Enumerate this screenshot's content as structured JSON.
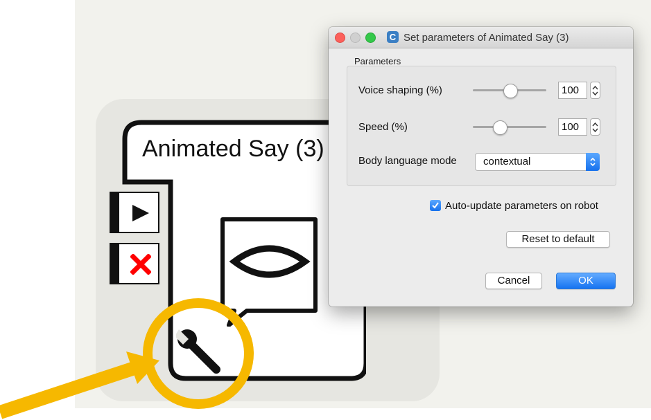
{
  "box": {
    "title": "Animated Say (3)",
    "play_icon": "play-icon",
    "stop_icon": "red-x-icon",
    "speech_icon": "speech-bubble-lips-icon",
    "wrench_icon": "wrench-icon"
  },
  "dialog": {
    "title": "Set parameters of Animated Say (3)",
    "app_icon_letter": "C",
    "group_label": "Parameters",
    "voice_shaping": {
      "label": "Voice shaping (%)",
      "value": "100",
      "slider_fraction": 0.5
    },
    "speed": {
      "label": "Speed (%)",
      "value": "100",
      "slider_fraction": 0.35
    },
    "body_language": {
      "label": "Body language mode",
      "selected": "contextual"
    },
    "auto_update": {
      "label": "Auto-update parameters on robot",
      "checked": true
    },
    "reset_label": "Reset to default",
    "cancel_label": "Cancel",
    "ok_label": "OK"
  },
  "annotation": {
    "highlight_color": "#f6b800",
    "shape": "magnifier-circle-with-arrow"
  },
  "colors": {
    "accent": "#1671ed",
    "close": "#fc605b",
    "maximize": "#34c84a",
    "stop_red": "#ff0000"
  }
}
